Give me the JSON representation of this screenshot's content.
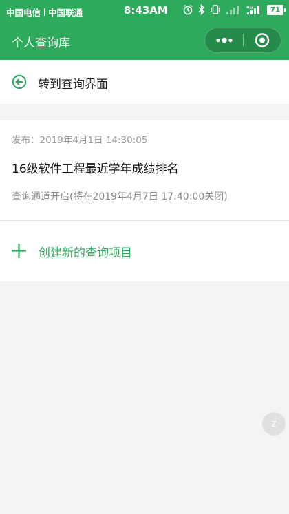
{
  "status_bar": {
    "carrier1": "中国电信",
    "carrier2": "中国联通",
    "time": "8:43AM",
    "network": "4G",
    "battery": "71",
    "icons": [
      "alarm-icon",
      "bluetooth-icon",
      "vibrate-icon",
      "signal-icon",
      "battery-icon"
    ]
  },
  "navbar": {
    "title": "个人查询库",
    "capsule_icons": [
      "more-dots-icon",
      "close-target-icon"
    ]
  },
  "nav_link": {
    "label": "转到查询界面",
    "icon": "back-arrow-icon"
  },
  "query_item": {
    "published": "发布：2019年4月1日 14:30:05",
    "title": "16级软件工程最近学年成绩排名",
    "status": "查询通道开启(将在2019年4月7日 17:40:00关闭)"
  },
  "create": {
    "label": "创建新的查询项目",
    "icon": "plus-icon"
  },
  "floating_button": {
    "label": "z"
  },
  "colors": {
    "brand_green": "#2eaa5c",
    "background": "#f4f4f4"
  }
}
